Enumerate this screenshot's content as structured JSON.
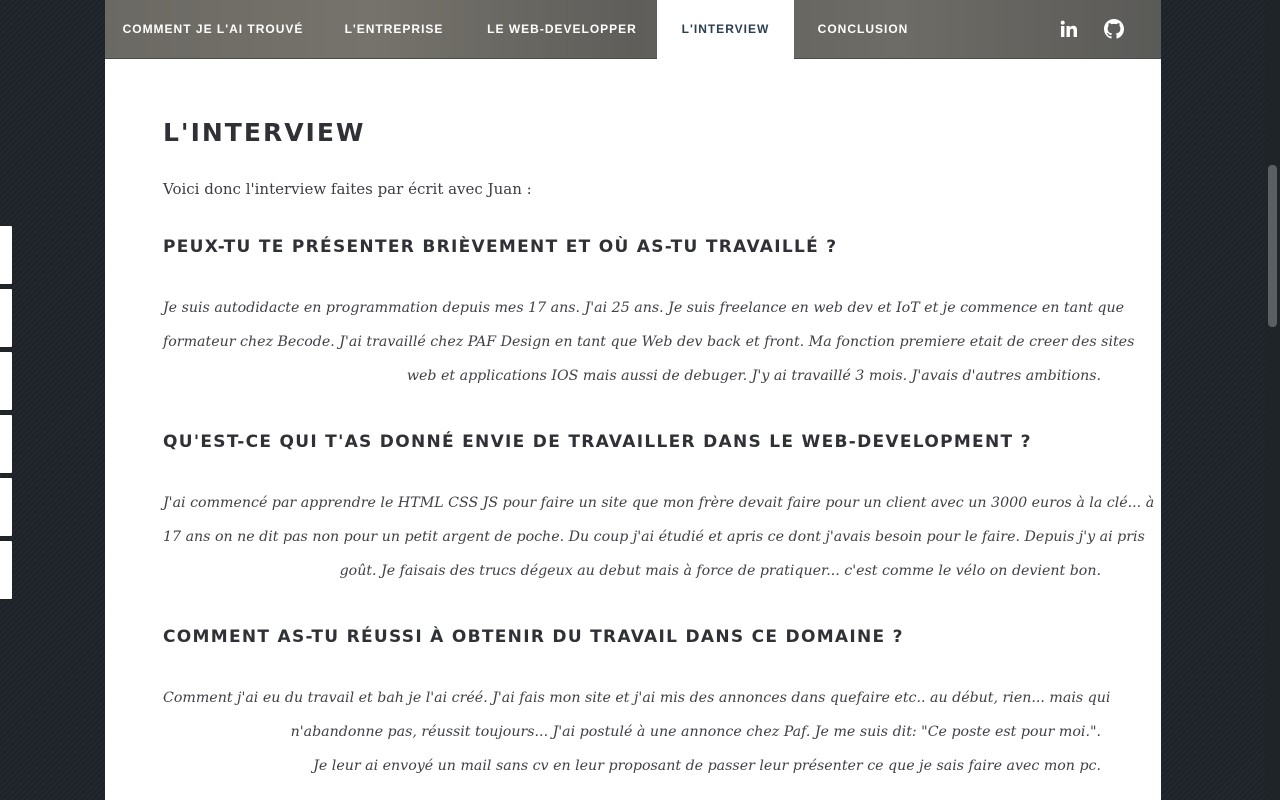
{
  "nav": {
    "items": [
      {
        "label": "COMMENT JE L'AI TROUVÉ",
        "active": false
      },
      {
        "label": "L'ENTREPRISE",
        "active": false
      },
      {
        "label": "LE WEB-DEVELOPPER",
        "active": false
      },
      {
        "label": "L'INTERVIEW",
        "active": true
      },
      {
        "label": "CONCLUSION",
        "active": false
      }
    ],
    "social_icons": [
      "linkedin-icon",
      "github-icon"
    ]
  },
  "main": {
    "title": "L'INTERVIEW",
    "intro": "Voici donc l'interview faites par écrit avec Juan :",
    "sections": [
      {
        "question": "PEUX-TU TE PRÉSENTER BRIÈVEMENT ET OÙ AS-TU TRAVAILLÉ ?",
        "answer_lines": [
          "Je suis autodidacte en programmation depuis mes 17 ans. J'ai 25 ans. Je suis freelance en web dev et IoT et je commence en tant que",
          "formateur chez Becode. J'ai travaillé chez PAF Design en tant que Web dev back et front. Ma fonction premiere etait de creer des sites",
          "web et applications IOS mais aussi de debuger. J'y ai travaillé 3 mois. J'avais d'autres ambitions."
        ]
      },
      {
        "question": "QU'EST-CE QUI T'AS DONNÉ ENVIE DE TRAVAILLER DANS LE WEB-DEVELOPMENT ?",
        "answer_lines": [
          "J'ai commencé par apprendre le HTML CSS JS pour faire un site que mon frère devait faire pour un client avec un 3000 euros à la clé... à",
          "17 ans on ne dit pas non pour un petit argent de poche. Du coup j'ai étudié et apris ce dont j'avais besoin pour le faire. Depuis j'y ai pris",
          "goût. Je faisais des trucs dégeux au debut mais à force de pratiquer... c'est comme le vélo on devient bon."
        ]
      },
      {
        "question": "COMMENT AS-TU RÉUSSI À OBTENIR DU TRAVAIL DANS CE DOMAINE ?",
        "answer_lines": [
          "Comment j'ai eu du travail et bah je l'ai créé. J'ai fais mon site et j'ai mis des annonces dans quefaire etc.. au début, rien... mais qui",
          "n'abandonne pas, réussit toujours... J'ai postulé à une annonce chez Paf. Je me suis dit: \"Ce poste est pour moi.\".",
          "Je leur ai envoyé un mail sans cv en leur proposant de passer leur présenter ce que je sais faire avec mon pc."
        ]
      }
    ]
  },
  "colors": {
    "background": "#1d2329",
    "heading": "#2f3136",
    "text": "#3d3f44",
    "nav_text": "#ffffff"
  }
}
